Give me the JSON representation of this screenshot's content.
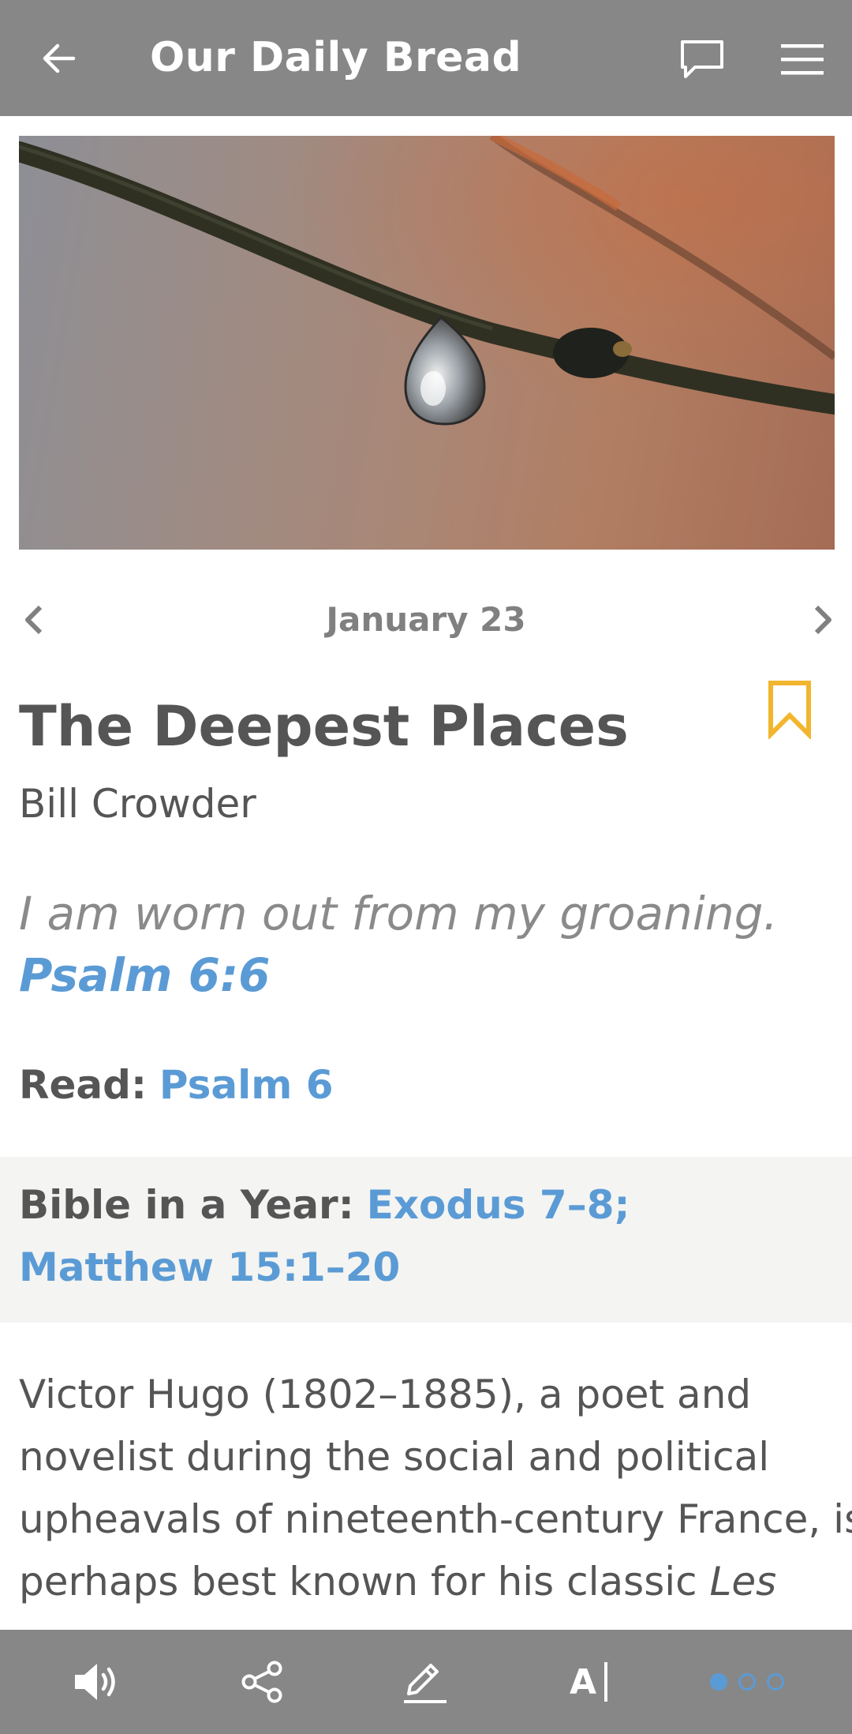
{
  "app_bar": {
    "title": "Our Daily Bread",
    "back_icon": "arrow-left-icon",
    "comment_icon": "comment-icon",
    "menu_icon": "hamburger-menu-icon"
  },
  "hero": {
    "image": "water-droplet-on-branch-photo"
  },
  "date_nav": {
    "date": "January 23",
    "prev_icon": "chevron-left-icon",
    "next_icon": "chevron-right-icon"
  },
  "article": {
    "title": "The Deepest Places",
    "author": "Bill Crowder",
    "bookmark_icon": "bookmark-icon",
    "bookmark_color": "#f2b52e",
    "verse_text": "I am worn out from my groaning.",
    "verse_ref": "Psalm 6:6",
    "read_label": "Read:",
    "read_link": "Psalm 6",
    "biy_label": "Bible in a Year:",
    "biy_link": "Exodus 7–8; Matthew 15:1–20",
    "body_lines": [
      "Victor Hugo (1802–1885), a poet and",
      "novelist during the social and political",
      "upheavals of nineteenth-century France, is",
      "perhaps best known for his classic "
    ],
    "body_italic_tail": "Les"
  },
  "bottom_bar": {
    "audio_icon": "speaker-icon",
    "share_icon": "share-icon",
    "note_icon": "pencil-icon",
    "font_icon": "text-size-icon",
    "font_label": "A",
    "page_count": 3,
    "active_page": 1
  },
  "colors": {
    "bar": "#878787",
    "link": "#5b9bd5",
    "text": "#555555",
    "muted": "#8a8a8a",
    "panel": "#f4f4f2"
  }
}
